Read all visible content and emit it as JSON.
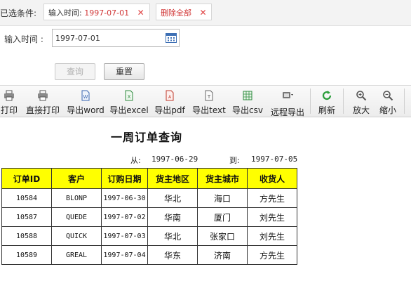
{
  "filter": {
    "title": "已选条件:",
    "chip_key": "输入时间:",
    "chip_value": "1997-07-01",
    "clear_all": "删除全部"
  },
  "form": {
    "field_label": "输入时间 :",
    "field_value": "1997-07-01",
    "query_label": "查询",
    "reset_label": "重置"
  },
  "toolbar": {
    "items": [
      {
        "label": "打印",
        "icon": "printer-icon"
      },
      {
        "label": "直接打印",
        "icon": "printer-icon"
      },
      {
        "label": "导出word",
        "icon": "word-icon"
      },
      {
        "label": "导出excel",
        "icon": "excel-icon"
      },
      {
        "label": "导出pdf",
        "icon": "pdf-icon"
      },
      {
        "label": "导出text",
        "icon": "text-icon"
      },
      {
        "label": "导出csv",
        "icon": "csv-icon"
      },
      {
        "label": "远程导出",
        "icon": "remote-export-icon"
      },
      {
        "label": "刷新",
        "icon": "refresh-icon"
      },
      {
        "label": "放大",
        "icon": "zoom-in-icon"
      },
      {
        "label": "缩小",
        "icon": "zoom-out-icon"
      }
    ]
  },
  "report": {
    "title": "一周订单查询",
    "from_label": "从:",
    "from_value": "1997-06-29",
    "to_label": "到:",
    "to_value": "1997-07-05",
    "headers": [
      "订单ID",
      "客户",
      "订购日期",
      "货主地区",
      "货主城市",
      "收货人"
    ],
    "rows": [
      [
        "10584",
        "BLONP",
        "1997-06-30",
        "华北",
        "海口",
        "方先生"
      ],
      [
        "10587",
        "QUEDE",
        "1997-07-02",
        "华南",
        "厦门",
        "刘先生"
      ],
      [
        "10588",
        "QUICK",
        "1997-07-03",
        "华北",
        "张家口",
        "刘先生"
      ],
      [
        "10589",
        "GREAL",
        "1997-07-04",
        "华东",
        "济南",
        "方先生"
      ]
    ]
  },
  "colors": {
    "header_fill": "#ffff00",
    "chip_value": "#d03434",
    "refresh_green": "#2a9d3a"
  }
}
